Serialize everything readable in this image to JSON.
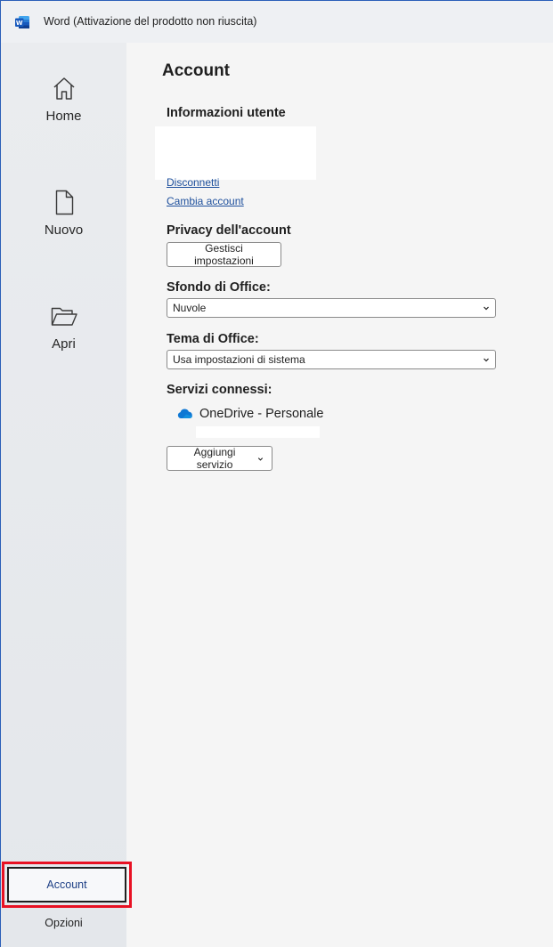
{
  "window": {
    "title": "Word (Attivazione del prodotto non riuscita)",
    "app_icon": "word-icon",
    "accent": "#2b5fb8"
  },
  "sidebar": {
    "items": [
      {
        "label": "Home",
        "icon": "home-icon"
      },
      {
        "label": "Nuovo",
        "icon": "new-document-icon"
      },
      {
        "label": "Apri",
        "icon": "folder-open-icon"
      }
    ],
    "account_label": "Account",
    "options_label": "Opzioni",
    "highlight_color": "#e81123"
  },
  "account": {
    "title": "Account",
    "user_info": {
      "heading": "Informazioni utente",
      "sign_out": "Disconnetti",
      "switch_account": "Cambia account"
    },
    "privacy": {
      "heading": "Privacy dell'account",
      "manage_button": "Gestisci impostazioni"
    },
    "background": {
      "heading": "Sfondo di Office:",
      "selected": "Nuvole"
    },
    "theme": {
      "heading": "Tema di Office:",
      "selected": "Usa impostazioni di sistema"
    },
    "services": {
      "heading": "Servizi connessi:",
      "items": [
        {
          "label": "OneDrive - Personale",
          "icon": "onedrive-cloud-icon",
          "color": "#0f78d4"
        }
      ],
      "add_button": "Aggiungi servizio"
    }
  }
}
